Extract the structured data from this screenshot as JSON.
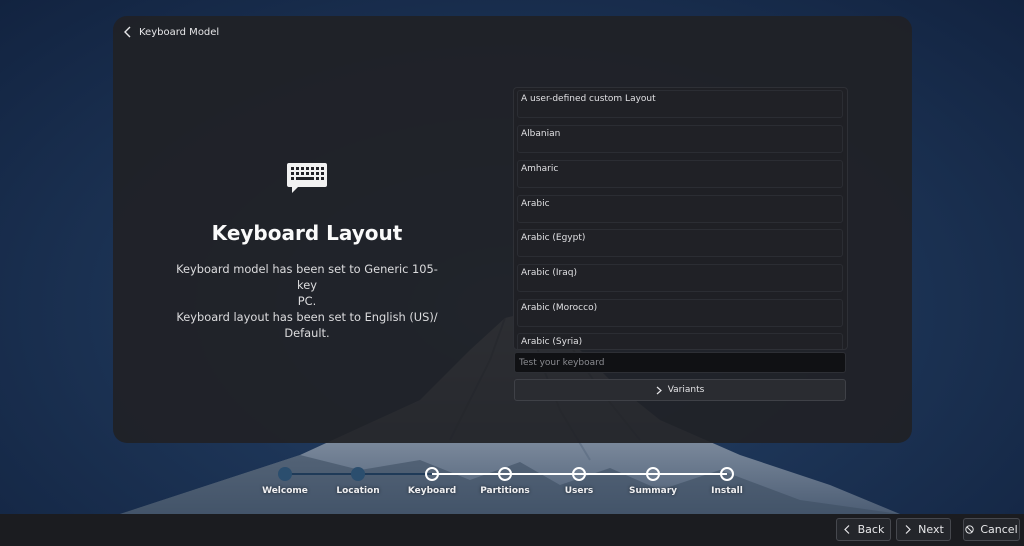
{
  "header": {
    "back_label": "Keyboard Model"
  },
  "intro": {
    "title": "Keyboard Layout",
    "description_line1": "Keyboard model has been set to Generic 105-key",
    "description_line2": "PC.",
    "description_line3": "Keyboard layout has been set to English (US)/",
    "description_line4": "Default."
  },
  "layouts": [
    {
      "label": "A user-defined custom Layout"
    },
    {
      "label": "Albanian"
    },
    {
      "label": "Amharic"
    },
    {
      "label": "Arabic"
    },
    {
      "label": "Arabic (Egypt)"
    },
    {
      "label": "Arabic (Iraq)"
    },
    {
      "label": "Arabic (Morocco)"
    },
    {
      "label": "Arabic (Syria)"
    }
  ],
  "test_input": {
    "placeholder": "Test your keyboard",
    "value": ""
  },
  "variants_button": {
    "label": "Variants"
  },
  "steps": [
    {
      "label": "Welcome",
      "state": "done"
    },
    {
      "label": "Location",
      "state": "done"
    },
    {
      "label": "Keyboard",
      "state": "current"
    },
    {
      "label": "Partitions",
      "state": "pending"
    },
    {
      "label": "Users",
      "state": "pending"
    },
    {
      "label": "Summary",
      "state": "pending"
    },
    {
      "label": "Install",
      "state": "pending"
    }
  ],
  "footer": {
    "back_label": "Back",
    "next_label": "Next",
    "cancel_label": "Cancel"
  },
  "colors": {
    "panel": "#202126",
    "accent_line": "#ffffff",
    "done_step": "#2b4e6e"
  }
}
